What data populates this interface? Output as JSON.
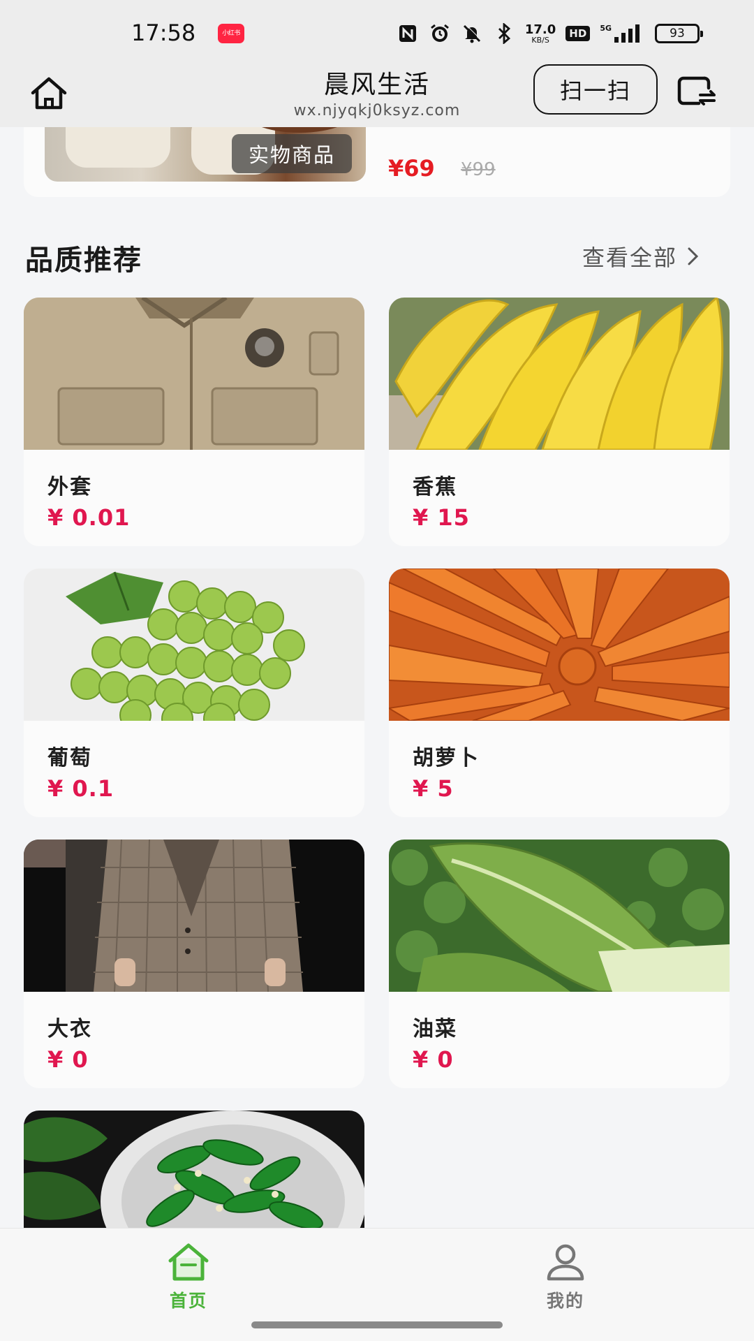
{
  "status_bar": {
    "time": "17:58",
    "notification_app": "小红书",
    "net_speed_value": "17.0",
    "net_speed_unit": "KB/S",
    "hd_label": "HD",
    "signal_label": "5G",
    "battery_level": "93",
    "icons": [
      "nfc-icon",
      "alarm-icon",
      "mute-icon",
      "bluetooth-icon",
      "signal-icon",
      "battery-icon"
    ]
  },
  "header": {
    "title": "晨风生活",
    "subtitle": "wx.njyqkj0ksyz.com",
    "scan_label": "扫一扫",
    "left_icon": "home-icon",
    "right_icon": "switch-account-icon"
  },
  "top_card": {
    "type_badge": "实物商品",
    "price": "¥69",
    "original_price": "¥99"
  },
  "section": {
    "title": "品质推荐",
    "view_all": "查看全部"
  },
  "products": [
    {
      "name": "外套",
      "price": "¥ 0.01"
    },
    {
      "name": "香蕉",
      "price": "¥ 15"
    },
    {
      "name": "葡萄",
      "price": "¥ 0.1"
    },
    {
      "name": "胡萝卜",
      "price": "¥ 5"
    },
    {
      "name": "大衣",
      "price": "¥ 0"
    },
    {
      "name": "油菜",
      "price": "¥ 0"
    }
  ],
  "bottom_nav": {
    "tabs": [
      {
        "label": "首页",
        "icon": "home-icon",
        "active": true
      },
      {
        "label": "我的",
        "icon": "user-icon",
        "active": false
      }
    ]
  },
  "colors": {
    "accent_green": "#4bb33a",
    "price_red": "#e0174f",
    "background": "#f4f5f7"
  }
}
